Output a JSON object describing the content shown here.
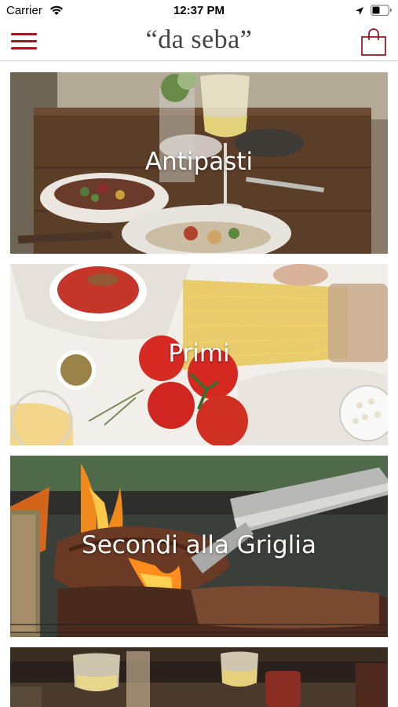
{
  "status_bar": {
    "carrier": "Carrier",
    "time": "12:37 PM"
  },
  "nav": {
    "title": "“da seba”",
    "accent_color": "#9e1a22"
  },
  "categories": [
    {
      "label": "Antipasti"
    },
    {
      "label": "Primi"
    },
    {
      "label": "Secondi alla Griglia"
    },
    {
      "label": ""
    }
  ]
}
